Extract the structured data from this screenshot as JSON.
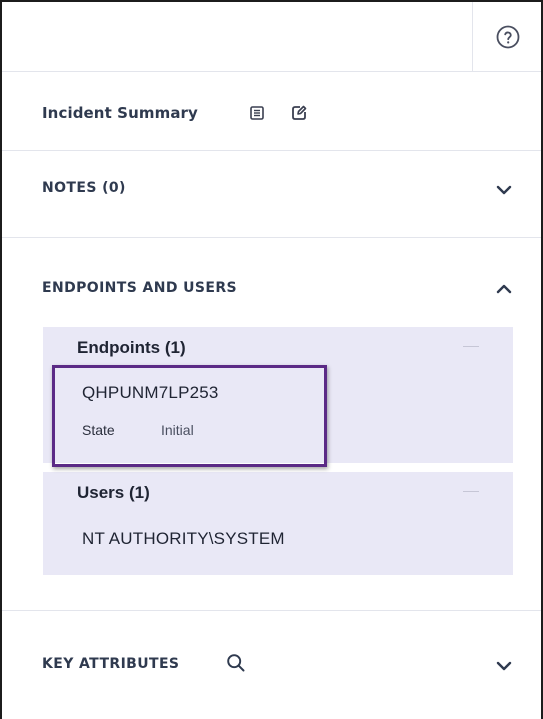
{
  "toolbar": {
    "help_icon": "question-circle-icon"
  },
  "incident": {
    "title": "Incident Summary",
    "icons": [
      "summary-document-icon",
      "edit-icon"
    ]
  },
  "notes": {
    "title": "NOTES (0)",
    "expanded": false
  },
  "endpoints_users": {
    "title": "ENDPOINTS AND USERS",
    "expanded": true,
    "endpoints": {
      "title": "Endpoints (1)",
      "items": [
        {
          "name": "QHPUNM7LP253",
          "state_label": "State",
          "state_value": "Initial"
        }
      ]
    },
    "users": {
      "title": "Users (1)",
      "items": [
        {
          "name": "NT AUTHORITY\\SYSTEM"
        }
      ]
    }
  },
  "key_attributes": {
    "title": "KEY ATTRIBUTES",
    "expanded": false
  },
  "colors": {
    "accent_highlight": "#5b2a86",
    "panel_background": "#e9e8f6",
    "heading_text": "#2f3a4f"
  }
}
